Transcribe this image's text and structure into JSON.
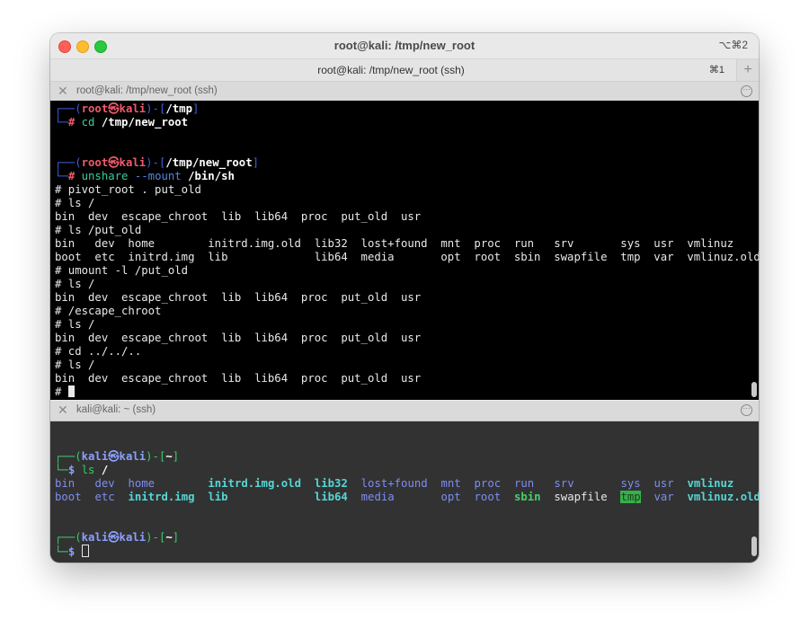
{
  "window": {
    "title": "root@kali: /tmp/new_root",
    "shortcut": "⌥⌘2"
  },
  "tabbar": {
    "title": "root@kali: /tmp/new_root (ssh)",
    "shortcut": "⌘1",
    "add": "+"
  },
  "pane1": {
    "title": "root@kali: /tmp/new_root (ssh)",
    "lines": {
      "p1_pre": "┌──(",
      "p1_user": "root㉿kali",
      "p1_mid": ")-[",
      "p1_path": "/tmp",
      "p1_end": "]",
      "c1_pre": "└─",
      "c1_hash": "# ",
      "c1_cmd": "cd",
      "c1_arg": " /tmp/new_root",
      "p2_pre": "┌──(",
      "p2_user": "root㉿kali",
      "p2_mid": ")-[",
      "p2_path": "/tmp/new_root",
      "p2_end": "]",
      "c2_pre": "└─",
      "c2_hash": "# ",
      "c2_cmd": "unshare",
      "c2_flag": " --mount",
      "c2_arg": " /bin/sh",
      "l1": "# pivot_root . put_old",
      "l2": "# ls /",
      "l3": "bin  dev  escape_chroot  lib  lib64  proc  put_old  usr",
      "l4": "# ls /put_old",
      "l5": "bin   dev  home        initrd.img.old  lib32  lost+found  mnt  proc  run   srv       sys  usr  vmlinuz",
      "l6": "boot  etc  initrd.img  lib             lib64  media       opt  root  sbin  swapfile  tmp  var  vmlinuz.old",
      "l7": "# umount -l /put_old",
      "l8": "# ls /",
      "l9": "bin  dev  escape_chroot  lib  lib64  proc  put_old  usr",
      "l10": "# /escape_chroot",
      "l11": "# ls /",
      "l12": "bin  dev  escape_chroot  lib  lib64  proc  put_old  usr",
      "l13": "# cd ../../..",
      "l14": "# ls /",
      "l15": "bin  dev  escape_chroot  lib  lib64  proc  put_old  usr",
      "l16": "# "
    }
  },
  "pane2": {
    "title": "kali@kali: ~ (ssh)",
    "prompt1": {
      "pre": "┌──(",
      "user": "kali㉿kali",
      "mid": ")-[",
      "path": "~",
      "end": "]"
    },
    "cmd1": {
      "pre": "└─",
      "dollar": "$ ",
      "cmd": "ls",
      "arg": " /"
    },
    "ls_row1": [
      {
        "t": "bin",
        "c": "dir",
        "g": "   "
      },
      {
        "t": "dev",
        "c": "dir",
        "g": "  "
      },
      {
        "t": "home",
        "c": "dir",
        "g": "        "
      },
      {
        "t": "initrd.img.old",
        "c": "lnk",
        "g": "  "
      },
      {
        "t": "lib32",
        "c": "lnk",
        "g": "  "
      },
      {
        "t": "lost+found",
        "c": "dir",
        "g": "  "
      },
      {
        "t": "mnt",
        "c": "dir",
        "g": "  "
      },
      {
        "t": "proc",
        "c": "dir",
        "g": "  "
      },
      {
        "t": "run",
        "c": "dir",
        "g": "   "
      },
      {
        "t": "srv",
        "c": "dir",
        "g": "       "
      },
      {
        "t": "sys",
        "c": "dir",
        "g": "  "
      },
      {
        "t": "usr",
        "c": "dir",
        "g": "  "
      },
      {
        "t": "vmlinuz",
        "c": "lnk",
        "g": ""
      }
    ],
    "ls_row2": [
      {
        "t": "boot",
        "c": "dir",
        "g": "  "
      },
      {
        "t": "etc",
        "c": "dir",
        "g": "  "
      },
      {
        "t": "initrd.img",
        "c": "lnk",
        "g": "  "
      },
      {
        "t": "lib",
        "c": "lnk",
        "g": "             "
      },
      {
        "t": "lib64",
        "c": "lnk",
        "g": "  "
      },
      {
        "t": "media",
        "c": "dir",
        "g": "       "
      },
      {
        "t": "opt",
        "c": "dir",
        "g": "  "
      },
      {
        "t": "root",
        "c": "dir",
        "g": "  "
      },
      {
        "t": "sbin",
        "c": "exe",
        "g": "  "
      },
      {
        "t": "swapfile",
        "c": "plain",
        "g": "  "
      },
      {
        "t": "tmp",
        "c": "hl",
        "g": "  "
      },
      {
        "t": "var",
        "c": "dir",
        "g": "  "
      },
      {
        "t": "vmlinuz.old",
        "c": "lnk",
        "g": ""
      }
    ],
    "prompt2": {
      "pre": "┌──(",
      "user": "kali㉿kali",
      "mid": ")-[",
      "path": "~",
      "end": "]"
    },
    "cmd2": {
      "pre": "└─",
      "dollar": "$ "
    }
  },
  "colors": {
    "pane1_bg": "#000000",
    "pane2_bg": "#323232",
    "prompt_red": "#ee5b6b",
    "command_teal": "#3ec9a2",
    "dir_blue": "#7d8df2",
    "highlight_green": "#36b14a"
  }
}
